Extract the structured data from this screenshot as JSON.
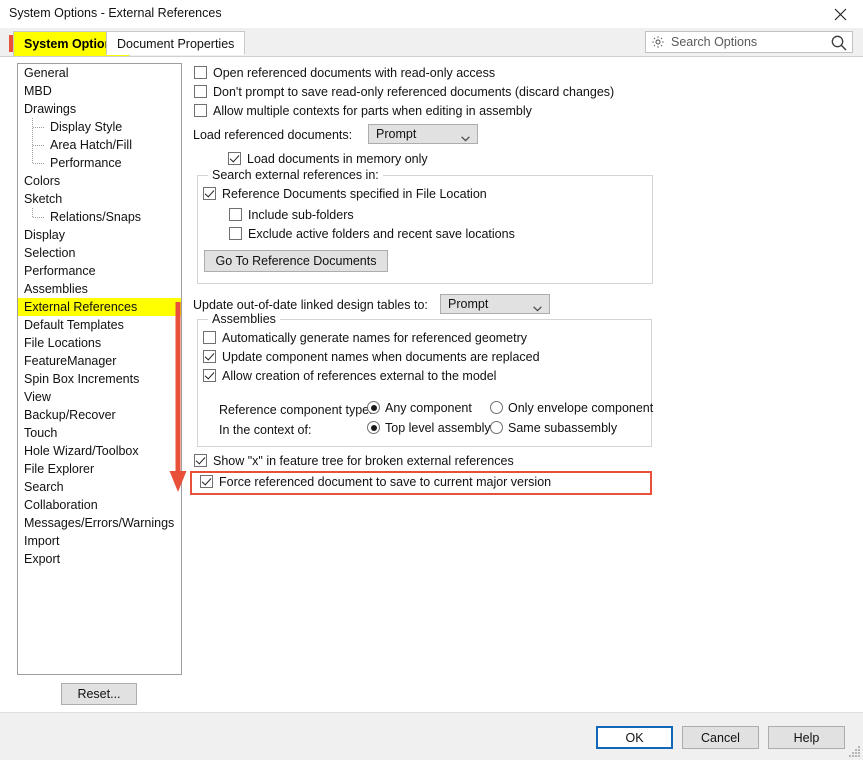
{
  "window": {
    "title": "System Options - External References",
    "close_icon": "close-icon"
  },
  "tabs": [
    {
      "label": "System Options",
      "active": true
    },
    {
      "label": "Document Properties",
      "active": false
    }
  ],
  "search": {
    "placeholder": "Search Options",
    "gear_icon": "gear-icon",
    "magnifier_icon": "search-icon"
  },
  "sidebar": {
    "items": [
      {
        "label": "General",
        "level": 0,
        "selected": false
      },
      {
        "label": "MBD",
        "level": 0,
        "selected": false
      },
      {
        "label": "Drawings",
        "level": 0,
        "selected": false
      },
      {
        "label": "Display Style",
        "level": 1,
        "selected": false
      },
      {
        "label": "Area Hatch/Fill",
        "level": 1,
        "selected": false
      },
      {
        "label": "Performance",
        "level": 1,
        "selected": false
      },
      {
        "label": "Colors",
        "level": 0,
        "selected": false
      },
      {
        "label": "Sketch",
        "level": 0,
        "selected": false
      },
      {
        "label": "Relations/Snaps",
        "level": 1,
        "selected": false
      },
      {
        "label": "Display",
        "level": 0,
        "selected": false
      },
      {
        "label": "Selection",
        "level": 0,
        "selected": false
      },
      {
        "label": "Performance",
        "level": 0,
        "selected": false
      },
      {
        "label": "Assemblies",
        "level": 0,
        "selected": false
      },
      {
        "label": "External References",
        "level": 0,
        "selected": true
      },
      {
        "label": "Default Templates",
        "level": 0,
        "selected": false
      },
      {
        "label": "File Locations",
        "level": 0,
        "selected": false
      },
      {
        "label": "FeatureManager",
        "level": 0,
        "selected": false
      },
      {
        "label": "Spin Box Increments",
        "level": 0,
        "selected": false
      },
      {
        "label": "View",
        "level": 0,
        "selected": false
      },
      {
        "label": "Backup/Recover",
        "level": 0,
        "selected": false
      },
      {
        "label": "Touch",
        "level": 0,
        "selected": false
      },
      {
        "label": "Hole Wizard/Toolbox",
        "level": 0,
        "selected": false
      },
      {
        "label": "File Explorer",
        "level": 0,
        "selected": false
      },
      {
        "label": "Search",
        "level": 0,
        "selected": false
      },
      {
        "label": "Collaboration",
        "level": 0,
        "selected": false
      },
      {
        "label": "Messages/Errors/Warnings",
        "level": 0,
        "selected": false
      },
      {
        "label": "Import",
        "level": 0,
        "selected": false
      },
      {
        "label": "Export",
        "level": 0,
        "selected": false
      }
    ],
    "reset_label": "Reset..."
  },
  "options": {
    "open_readonly": "Open referenced documents with read-only access",
    "dont_prompt_save": "Don't prompt to save read-only referenced documents (discard changes)",
    "allow_multiple_contexts": "Allow multiple contexts for parts when editing in assembly",
    "load_referenced_label": "Load referenced documents:",
    "load_referenced_value": "Prompt",
    "load_in_memory": "Load documents in memory only",
    "search_group_title": "Search external references in:",
    "reference_documents_specified": "Reference Documents specified in File Location",
    "include_subfolders": "Include sub-folders",
    "exclude_active_folders": "Exclude active folders and recent save locations",
    "go_to_reference_documents": "Go To Reference Documents",
    "update_linked_tables_label": "Update out-of-date linked design tables to:",
    "update_linked_tables_value": "Prompt",
    "assemblies_group_title": "Assemblies",
    "auto_generate_names": "Automatically generate names for referenced geometry",
    "update_component_names": "Update component names when documents are replaced",
    "allow_creation_external": "Allow creation of references external to the model",
    "reference_component_type_label": "Reference component type:",
    "any_component": "Any component",
    "only_envelope_component": "Only envelope component",
    "in_the_context_of_label": "In the context of:",
    "top_level_assembly": "Top level assembly",
    "same_subassembly": "Same subassembly",
    "show_x_broken_refs": "Show \"x\" in feature tree for broken external references",
    "force_referenced_save": "Force referenced document to save to current major version"
  },
  "buttons": {
    "ok": "OK",
    "cancel": "Cancel",
    "help": "Help"
  },
  "annotations": {
    "highlight_color": "#ffff00",
    "marker_color": "#e8503a"
  }
}
